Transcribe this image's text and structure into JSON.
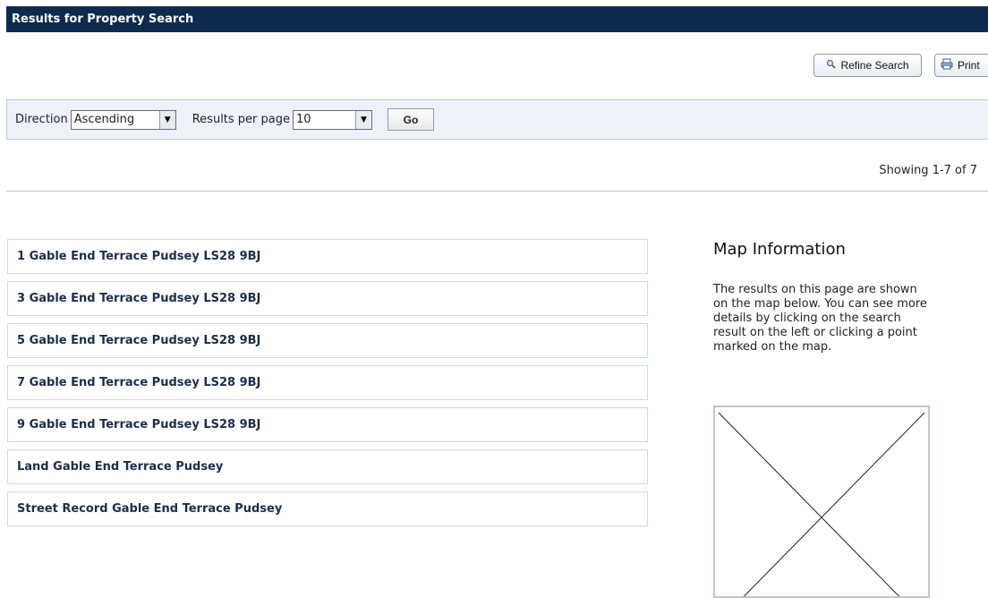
{
  "header": {
    "title": "Results for Property Search"
  },
  "actions": {
    "refine_label": "Refine Search",
    "print_label": "Print"
  },
  "toolbar": {
    "direction_label": "Direction",
    "direction_value": "Ascending",
    "rpp_label": "Results per page",
    "rpp_value": "10",
    "go_label": "Go"
  },
  "showing": "Showing 1-7 of 7",
  "results": [
    "1 Gable End Terrace Pudsey LS28 9BJ",
    "3 Gable End Terrace Pudsey LS28 9BJ",
    "5 Gable End Terrace Pudsey LS28 9BJ",
    "7 Gable End Terrace Pudsey LS28 9BJ",
    "9 Gable End Terrace Pudsey LS28 9BJ",
    "Land Gable End Terrace Pudsey",
    "Street Record Gable End Terrace Pudsey"
  ],
  "map": {
    "title": "Map Information",
    "description": "The results on this page are shown on the map below. You can see more details by clicking on the search result on the left or clicking a point marked on the map."
  },
  "icons": {
    "refine": "magnifier-icon",
    "print": "printer-icon",
    "dropdown": "chevron-down-icon"
  }
}
